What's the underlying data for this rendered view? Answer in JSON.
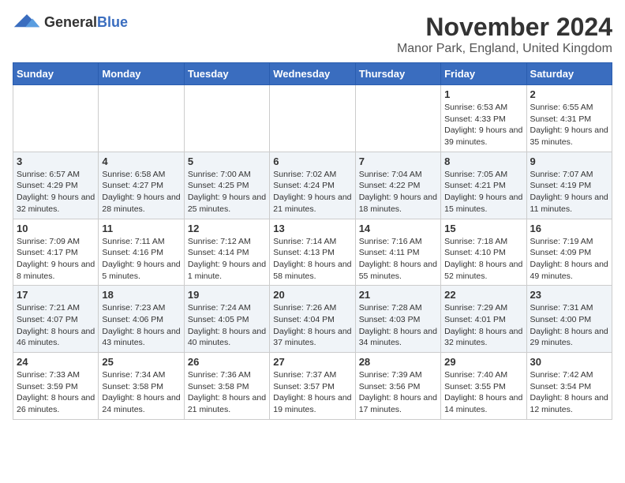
{
  "header": {
    "logo_general": "General",
    "logo_blue": "Blue",
    "title": "November 2024",
    "subtitle": "Manor Park, England, United Kingdom"
  },
  "weekdays": [
    "Sunday",
    "Monday",
    "Tuesday",
    "Wednesday",
    "Thursday",
    "Friday",
    "Saturday"
  ],
  "weeks": [
    [
      {
        "day": "",
        "info": ""
      },
      {
        "day": "",
        "info": ""
      },
      {
        "day": "",
        "info": ""
      },
      {
        "day": "",
        "info": ""
      },
      {
        "day": "",
        "info": ""
      },
      {
        "day": "1",
        "info": "Sunrise: 6:53 AM\nSunset: 4:33 PM\nDaylight: 9 hours\nand 39 minutes."
      },
      {
        "day": "2",
        "info": "Sunrise: 6:55 AM\nSunset: 4:31 PM\nDaylight: 9 hours\nand 35 minutes."
      }
    ],
    [
      {
        "day": "3",
        "info": "Sunrise: 6:57 AM\nSunset: 4:29 PM\nDaylight: 9 hours\nand 32 minutes."
      },
      {
        "day": "4",
        "info": "Sunrise: 6:58 AM\nSunset: 4:27 PM\nDaylight: 9 hours\nand 28 minutes."
      },
      {
        "day": "5",
        "info": "Sunrise: 7:00 AM\nSunset: 4:25 PM\nDaylight: 9 hours\nand 25 minutes."
      },
      {
        "day": "6",
        "info": "Sunrise: 7:02 AM\nSunset: 4:24 PM\nDaylight: 9 hours\nand 21 minutes."
      },
      {
        "day": "7",
        "info": "Sunrise: 7:04 AM\nSunset: 4:22 PM\nDaylight: 9 hours\nand 18 minutes."
      },
      {
        "day": "8",
        "info": "Sunrise: 7:05 AM\nSunset: 4:21 PM\nDaylight: 9 hours\nand 15 minutes."
      },
      {
        "day": "9",
        "info": "Sunrise: 7:07 AM\nSunset: 4:19 PM\nDaylight: 9 hours\nand 11 minutes."
      }
    ],
    [
      {
        "day": "10",
        "info": "Sunrise: 7:09 AM\nSunset: 4:17 PM\nDaylight: 9 hours\nand 8 minutes."
      },
      {
        "day": "11",
        "info": "Sunrise: 7:11 AM\nSunset: 4:16 PM\nDaylight: 9 hours\nand 5 minutes."
      },
      {
        "day": "12",
        "info": "Sunrise: 7:12 AM\nSunset: 4:14 PM\nDaylight: 9 hours\nand 1 minute."
      },
      {
        "day": "13",
        "info": "Sunrise: 7:14 AM\nSunset: 4:13 PM\nDaylight: 8 hours\nand 58 minutes."
      },
      {
        "day": "14",
        "info": "Sunrise: 7:16 AM\nSunset: 4:11 PM\nDaylight: 8 hours\nand 55 minutes."
      },
      {
        "day": "15",
        "info": "Sunrise: 7:18 AM\nSunset: 4:10 PM\nDaylight: 8 hours\nand 52 minutes."
      },
      {
        "day": "16",
        "info": "Sunrise: 7:19 AM\nSunset: 4:09 PM\nDaylight: 8 hours\nand 49 minutes."
      }
    ],
    [
      {
        "day": "17",
        "info": "Sunrise: 7:21 AM\nSunset: 4:07 PM\nDaylight: 8 hours\nand 46 minutes."
      },
      {
        "day": "18",
        "info": "Sunrise: 7:23 AM\nSunset: 4:06 PM\nDaylight: 8 hours\nand 43 minutes."
      },
      {
        "day": "19",
        "info": "Sunrise: 7:24 AM\nSunset: 4:05 PM\nDaylight: 8 hours\nand 40 minutes."
      },
      {
        "day": "20",
        "info": "Sunrise: 7:26 AM\nSunset: 4:04 PM\nDaylight: 8 hours\nand 37 minutes."
      },
      {
        "day": "21",
        "info": "Sunrise: 7:28 AM\nSunset: 4:03 PM\nDaylight: 8 hours\nand 34 minutes."
      },
      {
        "day": "22",
        "info": "Sunrise: 7:29 AM\nSunset: 4:01 PM\nDaylight: 8 hours\nand 32 minutes."
      },
      {
        "day": "23",
        "info": "Sunrise: 7:31 AM\nSunset: 4:00 PM\nDaylight: 8 hours\nand 29 minutes."
      }
    ],
    [
      {
        "day": "24",
        "info": "Sunrise: 7:33 AM\nSunset: 3:59 PM\nDaylight: 8 hours\nand 26 minutes."
      },
      {
        "day": "25",
        "info": "Sunrise: 7:34 AM\nSunset: 3:58 PM\nDaylight: 8 hours\nand 24 minutes."
      },
      {
        "day": "26",
        "info": "Sunrise: 7:36 AM\nSunset: 3:58 PM\nDaylight: 8 hours\nand 21 minutes."
      },
      {
        "day": "27",
        "info": "Sunrise: 7:37 AM\nSunset: 3:57 PM\nDaylight: 8 hours\nand 19 minutes."
      },
      {
        "day": "28",
        "info": "Sunrise: 7:39 AM\nSunset: 3:56 PM\nDaylight: 8 hours\nand 17 minutes."
      },
      {
        "day": "29",
        "info": "Sunrise: 7:40 AM\nSunset: 3:55 PM\nDaylight: 8 hours\nand 14 minutes."
      },
      {
        "day": "30",
        "info": "Sunrise: 7:42 AM\nSunset: 3:54 PM\nDaylight: 8 hours\nand 12 minutes."
      }
    ]
  ]
}
